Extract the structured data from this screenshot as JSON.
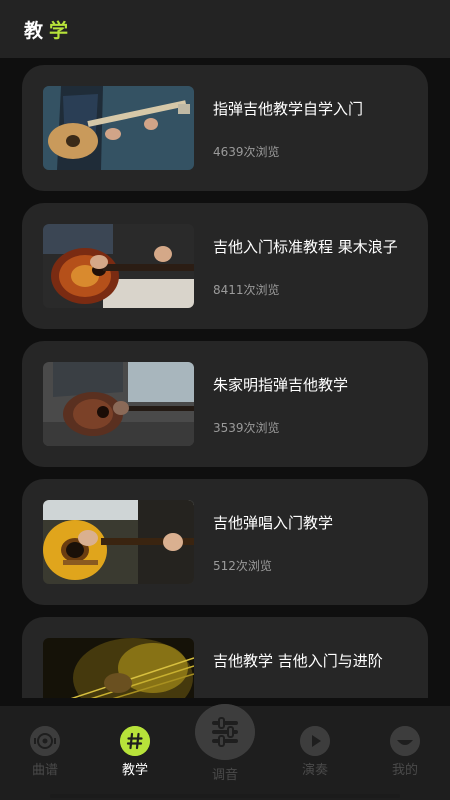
{
  "header": {
    "title_part1": "教",
    "title_part2": "学"
  },
  "courses": [
    {
      "title": "指弹吉他教学自学入门",
      "views": "4639次浏览"
    },
    {
      "title": "吉他入门标准教程 果木浪子",
      "views": "8411次浏览"
    },
    {
      "title": "朱家明指弹吉他教学",
      "views": "3539次浏览"
    },
    {
      "title": "吉他弹唱入门教学",
      "views": "512次浏览"
    },
    {
      "title": "吉他教学 吉他入门与进阶",
      "views": ""
    }
  ],
  "tabs": [
    {
      "label": "曲谱",
      "icon": "vinyl-icon"
    },
    {
      "label": "教学",
      "icon": "hash-icon"
    },
    {
      "label": "调音",
      "icon": "tuner-sliders-icon"
    },
    {
      "label": "演奏",
      "icon": "play-icon"
    },
    {
      "label": "我的",
      "icon": "smile-icon"
    }
  ],
  "colors": {
    "accent": "#b7e23a",
    "card": "#262626",
    "background": "#0f0f0f"
  }
}
